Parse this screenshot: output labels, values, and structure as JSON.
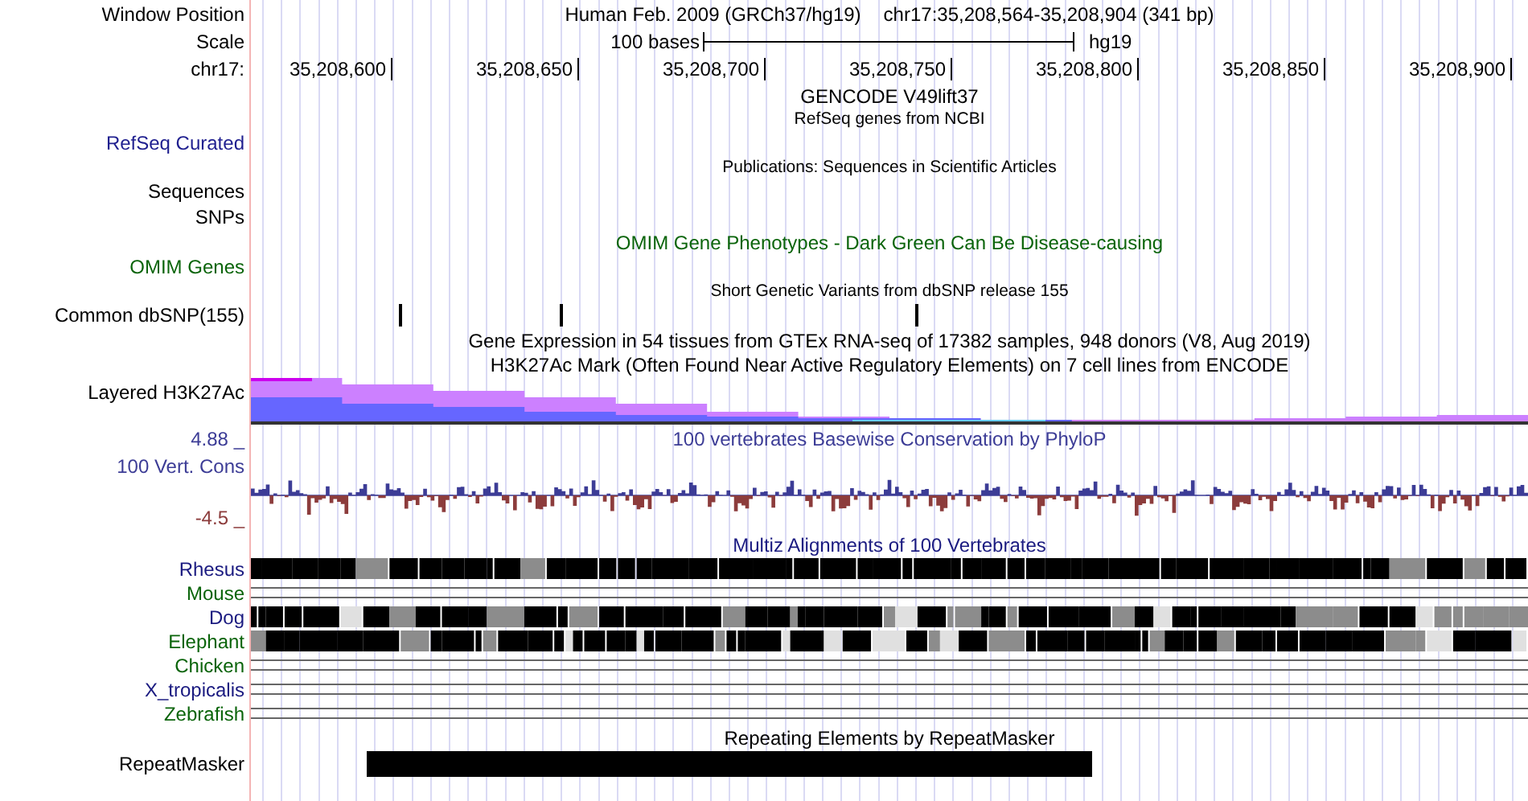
{
  "header": {
    "position_label": "Window Position",
    "assembly_title": "Human Feb. 2009 (GRCh37/hg19)",
    "position": "chr17:35,208,564-35,208,904 (341 bp)",
    "scale_label": "Scale",
    "scale_text": "100 bases",
    "assembly": "hg19",
    "chrom_label": "chr17:",
    "ruler_ticks": [
      "35,208,600",
      "35,208,650",
      "35,208,700",
      "35,208,750",
      "35,208,800",
      "35,208,850",
      "35,208,900"
    ]
  },
  "tracks": [
    {
      "kind": "title_only",
      "title": {
        "text": "GENCODE V49lift37",
        "small": false,
        "color": "#000000"
      }
    },
    {
      "kind": "empty",
      "title": {
        "text": "RefSeq genes from NCBI",
        "small": true,
        "color": "#000000"
      },
      "label": {
        "text": "RefSeq Curated",
        "color": "#1f1f8f"
      }
    },
    {
      "kind": "empty",
      "title": {
        "text": "Publications: Sequences in Scientific Articles",
        "small": true,
        "color": "#000000"
      },
      "label": {
        "text": "Sequences",
        "color": "#000000"
      }
    },
    {
      "kind": "empty",
      "label": {
        "text": "SNPs",
        "color": "#000000"
      }
    },
    {
      "kind": "empty",
      "title": {
        "text": "OMIM Gene Phenotypes - Dark Green Can Be Disease-causing",
        "small": false,
        "color": "#0a640a"
      },
      "label": {
        "text": "OMIM Genes",
        "color": "#0a640a"
      }
    },
    {
      "kind": "variants",
      "title": {
        "text": "Short Genetic Variants from dbSNP release 155",
        "small": true,
        "color": "#000000"
      },
      "label": {
        "text": "Common dbSNP(155)",
        "color": "#000000"
      }
    },
    {
      "kind": "title_only",
      "title": {
        "text": "Gene Expression in 54 tissues from GTEx RNA-seq of 17382 samples, 948 donors (V8, Aug 2019)",
        "small": false,
        "color": "#000000"
      }
    },
    {
      "kind": "layered",
      "title": {
        "text": "H3K27Ac Mark (Often Found Near Active Regulatory Elements) on 7 cell lines from ENCODE",
        "small": false,
        "color": "#000000"
      },
      "label": {
        "text": "Layered H3K27Ac",
        "color": "#000000"
      }
    },
    {
      "kind": "wiggle",
      "title": {
        "text": "100 vertebrates Basewise Conservation by PhyloP",
        "small": false,
        "color": "#3c3c96"
      },
      "label": {
        "text": "100 Vert. Cons",
        "color": "#3c3c96"
      },
      "max_label": {
        "text": "4.88 _",
        "color": "#3c3c96"
      },
      "min_label": {
        "text": "-4.5 _",
        "color": "#8c3c3c"
      }
    },
    {
      "kind": "alignments",
      "title": {
        "text": "Multiz Alignments of 100 Vertebrates",
        "small": false,
        "color": "#1a1a80"
      },
      "species": [
        {
          "name": "Rhesus",
          "color": "#1a1a80",
          "kind": "aligned"
        },
        {
          "name": "Mouse",
          "color": "#0a640a",
          "kind": "unaligned"
        },
        {
          "name": "Dog",
          "color": "#1a1a80",
          "kind": "aligned"
        },
        {
          "name": "Elephant",
          "color": "#0a640a",
          "kind": "aligned"
        },
        {
          "name": "Chicken",
          "color": "#0a640a",
          "kind": "unaligned"
        },
        {
          "name": "X_tropicalis",
          "color": "#1a1a80",
          "kind": "unaligned"
        },
        {
          "name": "Zebrafish",
          "color": "#0a640a",
          "kind": "unaligned"
        }
      ]
    },
    {
      "kind": "repeats",
      "title": {
        "text": "Repeating Elements by RepeatMasker",
        "small": false,
        "color": "#000000"
      },
      "label": {
        "text": "RepeatMasker",
        "color": "#000000"
      }
    }
  ]
}
